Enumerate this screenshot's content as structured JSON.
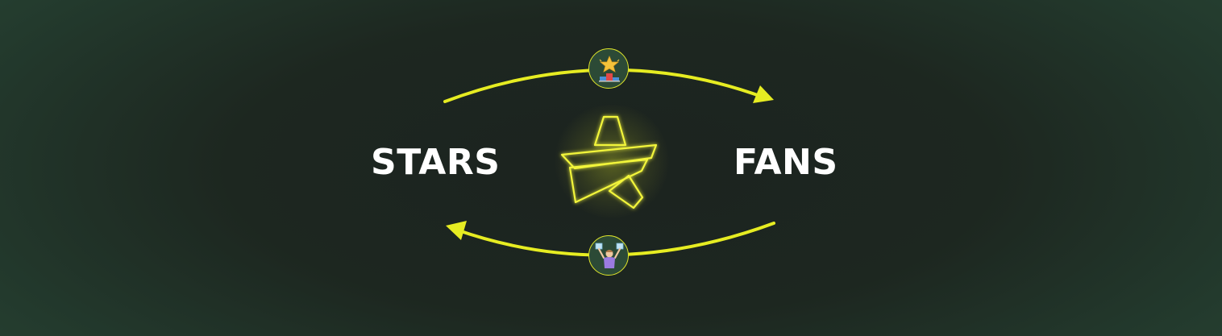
{
  "diagram": {
    "left_label": "STARS",
    "right_label": "FANS",
    "top_badge_icon": "star-podium-icon",
    "bottom_badge_icon": "fan-cheering-icon",
    "center_icon": "neon-star-logo-icon",
    "top_arrow_direction": "left-to-right",
    "bottom_arrow_direction": "right-to-left"
  },
  "colors": {
    "accent": "#e6ec22",
    "badge_fill": "#2c4a36",
    "text": "#ffffff"
  }
}
